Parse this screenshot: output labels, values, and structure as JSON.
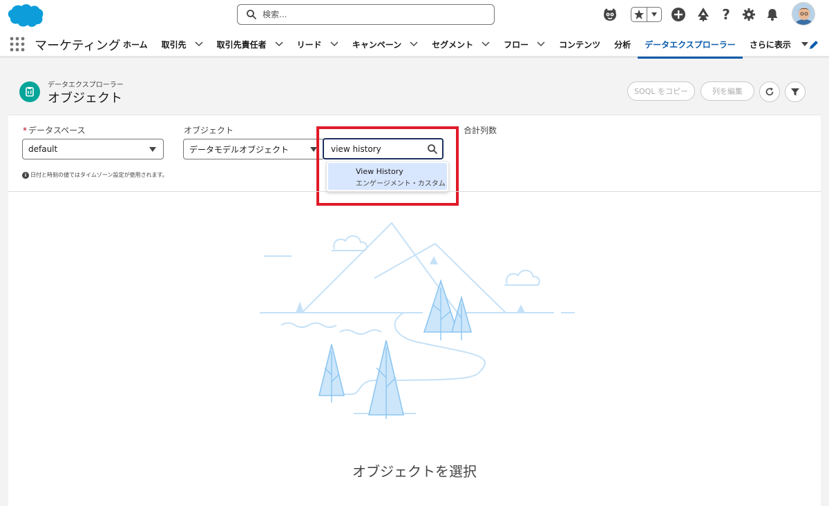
{
  "header": {
    "search_placeholder": "検索...",
    "icons": [
      "salesforce-logo",
      "einstein-icon",
      "favorites-star-icon",
      "add-icon",
      "trailhead-icon",
      "help-icon",
      "setup-gear-icon",
      "notification-bell-icon",
      "user-avatar"
    ]
  },
  "nav": {
    "app_name": "マーケティング",
    "items": [
      {
        "label": "ホーム",
        "has_menu": false
      },
      {
        "label": "取引先",
        "has_menu": true
      },
      {
        "label": "取引先責任者",
        "has_menu": true
      },
      {
        "label": "リード",
        "has_menu": true
      },
      {
        "label": "キャンペーン",
        "has_menu": true
      },
      {
        "label": "セグメント",
        "has_menu": true
      },
      {
        "label": "フロー",
        "has_menu": true
      },
      {
        "label": "コンテンツ",
        "has_menu": false
      },
      {
        "label": "分析",
        "has_menu": false
      },
      {
        "label": "データエクスプローラー",
        "has_menu": false,
        "active": true
      }
    ],
    "more_label": "さらに表示"
  },
  "page_header": {
    "subtitle": "データエクスプローラー",
    "title": "オブジェクト",
    "copy_soql_label": "SOQL をコピー",
    "edit_columns_label": "列を編集"
  },
  "filters": {
    "dataspace_label": "データスペース",
    "dataspace_value": "default",
    "object_label": "オブジェクト",
    "object_value": "データモデルオブジェクト",
    "search_value": "view history",
    "total_columns_label": "合計列数",
    "info_text": "日付と時刻の値ではタイムゾーン設定が使用されます。"
  },
  "dropdown": {
    "items": [
      {
        "title": "View History",
        "subtitle": "エンゲージメント・カスタム"
      }
    ]
  },
  "empty_state": {
    "message": "オブジェクトを選択"
  },
  "colors": {
    "brand_blue": "#0b5cab",
    "highlight_red": "#e01a28",
    "object_icon_teal": "#06a59a",
    "selection_bg": "#d8e6fe"
  }
}
